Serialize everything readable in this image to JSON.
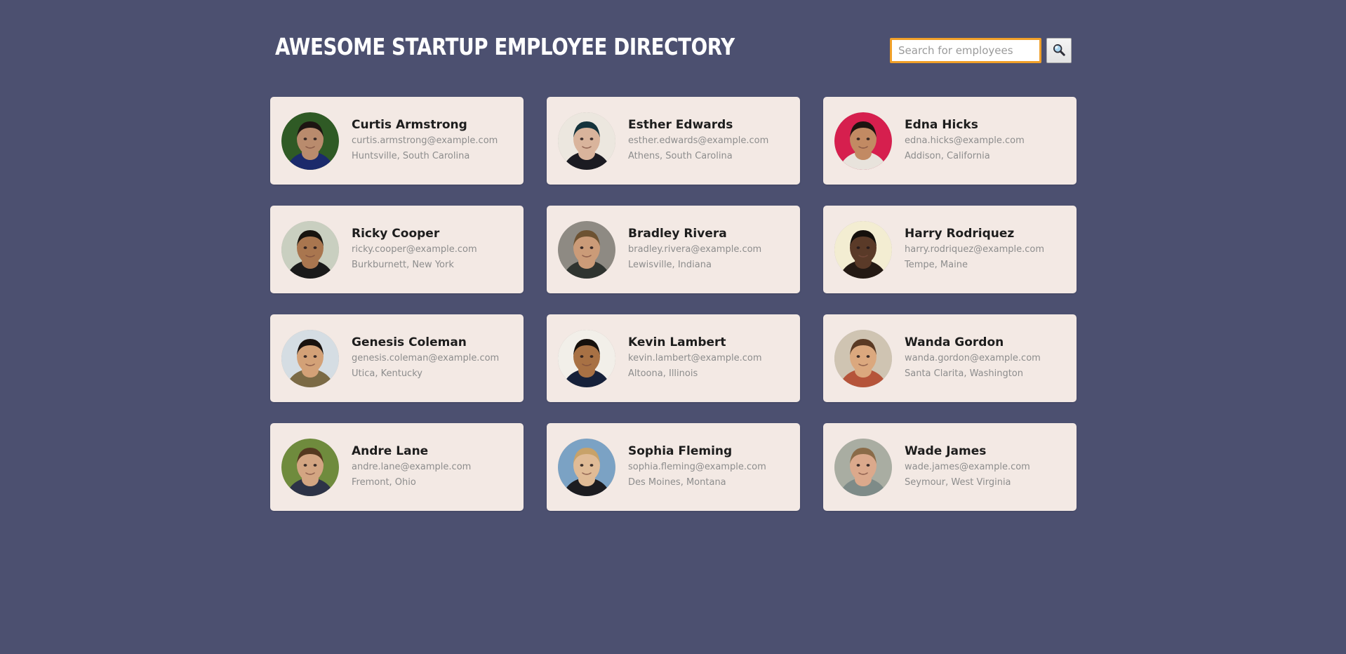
{
  "header": {
    "title": "AWESOME STARTUP EMPLOYEE DIRECTORY",
    "search": {
      "placeholder": "Search for employees",
      "value": "",
      "button_icon": "search-icon"
    }
  },
  "theme": {
    "background": "#4c5070",
    "card_background": "#f3e9e4",
    "accent_focus": "#f0a029",
    "title_color": "#ffffff",
    "name_color": "#1d1d1d",
    "muted_text": "#8d8d8d"
  },
  "employees": [
    {
      "name": "Curtis Armstrong",
      "email": "curtis.armstrong@example.com",
      "location": "Huntsville, South Carolina",
      "avatar": {
        "bg": "#2f5a25",
        "skin": "#b98b6d",
        "hair": "#1d1512",
        "shirt": "#1b2a6b"
      }
    },
    {
      "name": "Esther Edwards",
      "email": "esther.edwards@example.com",
      "location": "Athens, South Carolina",
      "avatar": {
        "bg": "#ece7df",
        "skin": "#d9b49c",
        "hair": "#15333c",
        "shirt": "#1b1b22"
      }
    },
    {
      "name": "Edna Hicks",
      "email": "edna.hicks@example.com",
      "location": "Addison, California",
      "avatar": {
        "bg": "#d61f4e",
        "skin": "#c28a63",
        "hair": "#1d1410",
        "shirt": "#e8e3dc"
      }
    },
    {
      "name": "Ricky Cooper",
      "email": "ricky.cooper@example.com",
      "location": "Burkburnett, New York",
      "avatar": {
        "bg": "#c9cfc0",
        "skin": "#a9764f",
        "hair": "#18140f",
        "shirt": "#1a1a1a"
      }
    },
    {
      "name": "Bradley Rivera",
      "email": "bradley.rivera@example.com",
      "location": "Lewisville, Indiana",
      "avatar": {
        "bg": "#8e8a83",
        "skin": "#cb9b78",
        "hair": "#6d5232",
        "shirt": "#2f3430"
      }
    },
    {
      "name": "Harry Rodriquez",
      "email": "harry.rodriquez@example.com",
      "location": "Tempe, Maine",
      "avatar": {
        "bg": "#f3edd2",
        "skin": "#5a3a28",
        "hair": "#140f0c",
        "shirt": "#241a14"
      }
    },
    {
      "name": "Genesis Coleman",
      "email": "genesis.coleman@example.com",
      "location": "Utica, Kentucky",
      "avatar": {
        "bg": "#d5dde3",
        "skin": "#d3a177",
        "hair": "#19120e",
        "shirt": "#7b6a45"
      }
    },
    {
      "name": "Kevin Lambert",
      "email": "kevin.lambert@example.com",
      "location": "Altoona, Illinois",
      "avatar": {
        "bg": "#f2efe9",
        "skin": "#a87144",
        "hair": "#16100c",
        "shirt": "#16213a"
      }
    },
    {
      "name": "Wanda Gordon",
      "email": "wanda.gordon@example.com",
      "location": "Santa Clarita, Washington",
      "avatar": {
        "bg": "#cfc4b2",
        "skin": "#dba87e",
        "hair": "#5a3a24",
        "shirt": "#b5543a"
      }
    },
    {
      "name": "Andre Lane",
      "email": "andre.lane@example.com",
      "location": "Fremont, Ohio",
      "avatar": {
        "bg": "#6f8b3d",
        "skin": "#d3a582",
        "hair": "#54381f",
        "shirt": "#2d3347"
      }
    },
    {
      "name": "Sophia Fleming",
      "email": "sophia.fleming@example.com",
      "location": "Des Moines, Montana",
      "avatar": {
        "bg": "#7ba2c4",
        "skin": "#e0bb96",
        "hair": "#c8a269",
        "shirt": "#1c1c20"
      }
    },
    {
      "name": "Wade James",
      "email": "wade.james@example.com",
      "location": "Seymour, West Virginia",
      "avatar": {
        "bg": "#a9ada2",
        "skin": "#dba98c",
        "hair": "#8a6b48",
        "shirt": "#7e8b88"
      }
    }
  ]
}
